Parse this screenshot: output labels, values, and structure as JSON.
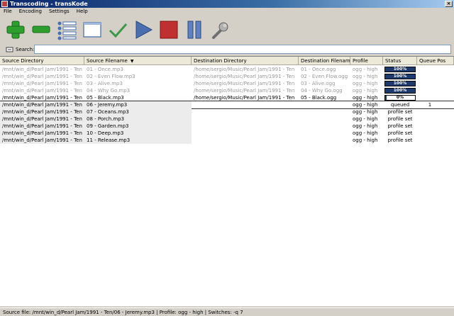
{
  "window": {
    "title": "Transcoding - transKode"
  },
  "menu": [
    "File",
    "Encoding",
    "Settings",
    "Help"
  ],
  "toolbar": [
    {
      "name": "add-button",
      "icon": "plus-icon"
    },
    {
      "name": "remove-button",
      "icon": "minus-icon"
    },
    {
      "name": "list-button",
      "icon": "list-icon"
    },
    {
      "name": "window-button",
      "icon": "window-icon"
    },
    {
      "name": "check-button",
      "icon": "checkmark-icon"
    },
    {
      "name": "play-button",
      "icon": "play-icon"
    },
    {
      "name": "stop-button",
      "icon": "stop-icon"
    },
    {
      "name": "pause-button",
      "icon": "pause-icon"
    },
    {
      "name": "settings-button",
      "icon": "wrench-icon"
    }
  ],
  "search": {
    "label": "Search:",
    "value": ""
  },
  "table": {
    "columns": [
      "Source Directory",
      "Source Filename",
      "Destination Directory",
      "Destination Filename",
      "Profile",
      "Status",
      "Queue Pos"
    ],
    "rows": [
      {
        "src_dir": "/mnt/win_d/Pearl Jam/1991 - Ten",
        "src_file": "01 - Once.mp3",
        "dst_dir": "/home/sergio/Music/Pearl Jam/1991 - Ten",
        "dst_file": "01 - Once.ogg",
        "profile": "ogg - high",
        "status": "100%",
        "progress": 100,
        "queue": "",
        "state": "completed"
      },
      {
        "src_dir": "/mnt/win_d/Pearl Jam/1991 - Ten",
        "src_file": "02 - Even Flow.mp3",
        "dst_dir": "/home/sergio/Music/Pearl Jam/1991 - Ten",
        "dst_file": "02 - Even Flow.ogg",
        "profile": "ogg - high",
        "status": "100%",
        "progress": 100,
        "queue": "",
        "state": "completed"
      },
      {
        "src_dir": "/mnt/win_d/Pearl Jam/1991 - Ten",
        "src_file": "03 - Alive.mp3",
        "dst_dir": "/home/sergio/Music/Pearl Jam/1991 - Ten",
        "dst_file": "03 - Alive.ogg",
        "profile": "ogg - high",
        "status": "100%",
        "progress": 100,
        "queue": "",
        "state": "completed"
      },
      {
        "src_dir": "/mnt/win_d/Pearl Jam/1991 - Ten",
        "src_file": "04 - Why Go.mp3",
        "dst_dir": "/home/sergio/Music/Pearl Jam/1991 - Ten",
        "dst_file": "04 - Why Go.ogg",
        "profile": "ogg - high",
        "status": "100%",
        "progress": 100,
        "queue": "",
        "state": "completed"
      },
      {
        "src_dir": "/mnt/win_d/Pearl Jam/1991 - Ten",
        "src_file": "05 - Black.mp3",
        "dst_dir": "/home/sergio/Music/Pearl Jam/1991 - Ten",
        "dst_file": "05 - Black.ogg",
        "profile": "ogg - high",
        "status": "0%",
        "progress": 0,
        "queue": "",
        "state": "active"
      },
      {
        "src_dir": "/mnt/win_d/Pearl Jam/1991 - Ten",
        "src_file": "06 - Jeremy.mp3",
        "dst_dir": "",
        "dst_file": "",
        "profile": "ogg - high",
        "status": "queued",
        "progress": null,
        "queue": "1",
        "state": "current"
      },
      {
        "src_dir": "/mnt/win_d/Pearl Jam/1991 - Ten",
        "src_file": "07 - Oceans.mp3",
        "dst_dir": "",
        "dst_file": "",
        "profile": "ogg - high",
        "status": "profile set",
        "progress": null,
        "queue": "",
        "state": "pending"
      },
      {
        "src_dir": "/mnt/win_d/Pearl Jam/1991 - Ten",
        "src_file": "08 - Porch.mp3",
        "dst_dir": "",
        "dst_file": "",
        "profile": "ogg - high",
        "status": "profile set",
        "progress": null,
        "queue": "",
        "state": "pending"
      },
      {
        "src_dir": "/mnt/win_d/Pearl Jam/1991 - Ten",
        "src_file": "09 - Garden.mp3",
        "dst_dir": "",
        "dst_file": "",
        "profile": "ogg - high",
        "status": "profile set",
        "progress": null,
        "queue": "",
        "state": "pending"
      },
      {
        "src_dir": "/mnt/win_d/Pearl Jam/1991 - Ten",
        "src_file": "10 - Deep.mp3",
        "dst_dir": "",
        "dst_file": "",
        "profile": "ogg - high",
        "status": "profile set",
        "progress": null,
        "queue": "",
        "state": "pending"
      },
      {
        "src_dir": "/mnt/win_d/Pearl Jam/1991 - Ten",
        "src_file": "11 - Release.mp3",
        "dst_dir": "",
        "dst_file": "",
        "profile": "ogg - high",
        "status": "profile set",
        "progress": null,
        "queue": "",
        "state": "pending"
      }
    ]
  },
  "statusbar": {
    "text": "Source file: /mnt/win_d/Pearl Jam/1991 - Ten/06 - Jeremy.mp3 | Profile: ogg - high | Switches: -q 7"
  },
  "colors": {
    "progress_fill": "#1c3a6e",
    "title_bar": "#0a246a",
    "play": "#4a6fb0",
    "stop": "#c03030",
    "add": "#2e9e2e"
  }
}
